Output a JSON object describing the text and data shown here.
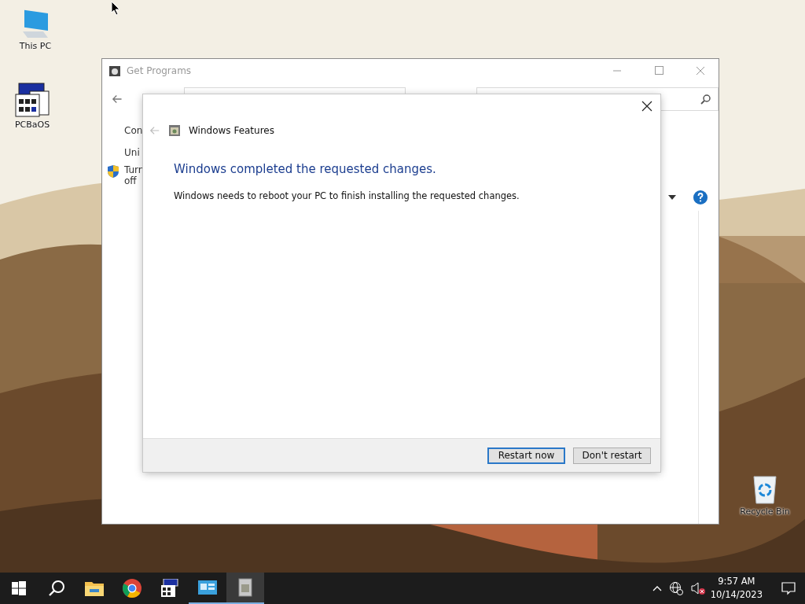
{
  "desktop_icons": [
    {
      "label": "This PC",
      "kind": "computer"
    },
    {
      "label": "PCBaOS",
      "kind": "app"
    },
    {
      "label": "Recycle Bin",
      "kind": "bin"
    }
  ],
  "window": {
    "title": "Get Programs",
    "sidebar_items": [
      {
        "label": "Con",
        "kind": "link"
      },
      {
        "label": "Uni",
        "kind": "link"
      },
      {
        "label": "Turn off",
        "kind": "shield"
      }
    ]
  },
  "dialog": {
    "title": "Windows Features",
    "heading": "Windows completed the requested changes.",
    "message": "Windows needs to reboot your PC to finish installing the requested changes.",
    "buttons": [
      {
        "label": "Restart now",
        "selected": true
      },
      {
        "label": "Don't restart",
        "selected": false
      }
    ]
  },
  "taskbar": {
    "apps": [
      {
        "kind": "folder",
        "running": false,
        "selected": false
      },
      {
        "kind": "browser",
        "running": false,
        "selected": false
      },
      {
        "kind": "app",
        "running": false,
        "selected": false
      },
      {
        "kind": "control",
        "running": true,
        "selected": false
      },
      {
        "kind": "programs",
        "running": true,
        "selected": true
      }
    ],
    "time": "9:57 AM",
    "date": "10/14/2023"
  }
}
